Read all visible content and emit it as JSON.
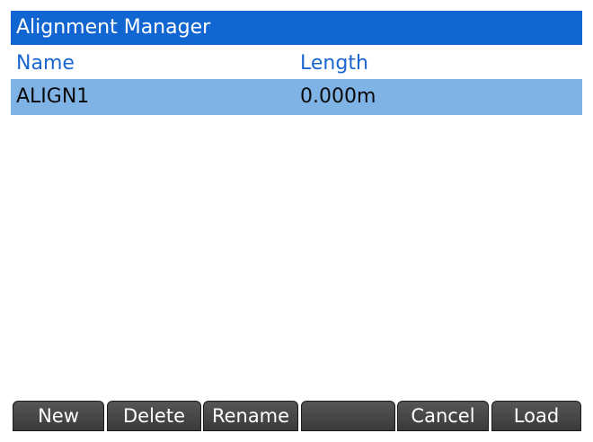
{
  "window": {
    "title": "Alignment Manager"
  },
  "table": {
    "columns": {
      "name": "Name",
      "length": "Length"
    },
    "rows": [
      {
        "name": "ALIGN1",
        "length": "0.000m",
        "selected": true
      }
    ]
  },
  "softkeys": [
    "New",
    "Delete",
    "Rename",
    "",
    "Cancel",
    "Load"
  ],
  "colors": {
    "title_bar": "#1266d2",
    "header_text": "#1a66d0",
    "selected_row": "#7fb3e6",
    "softkey": "#4a4a4a"
  }
}
